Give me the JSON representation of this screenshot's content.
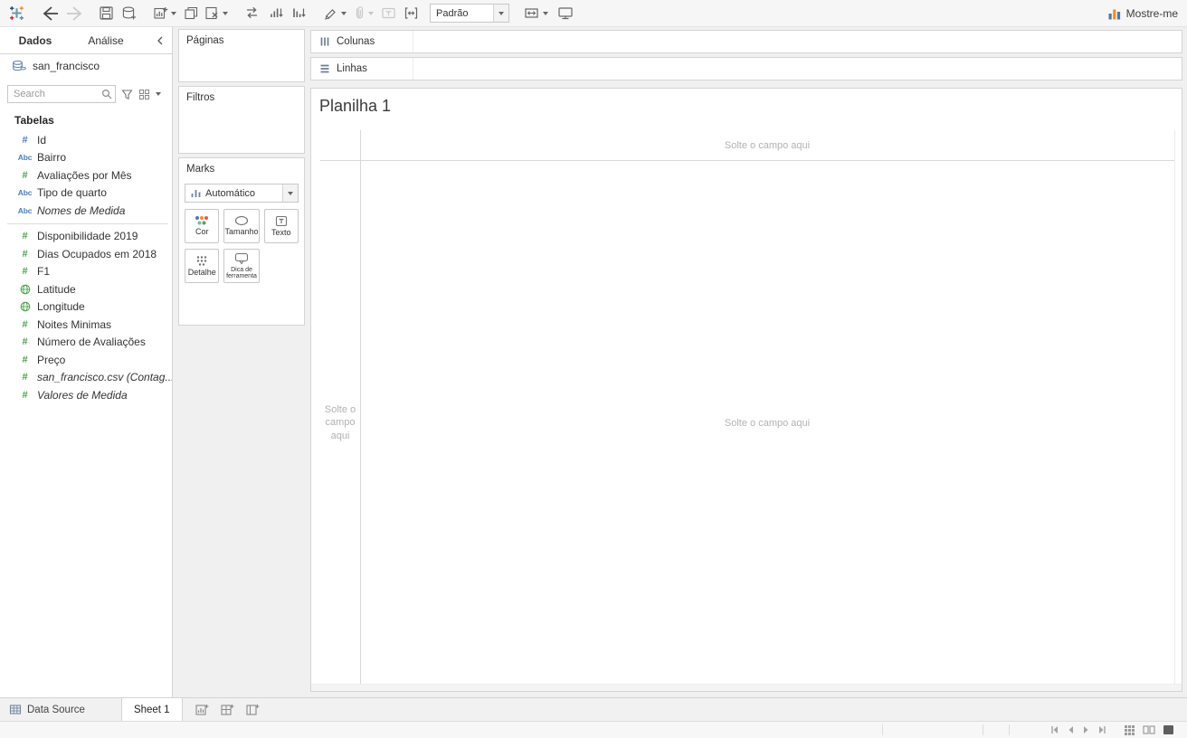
{
  "toolbar": {
    "format_select_value": "Padrão",
    "show_me_label": "Mostre-me"
  },
  "sidebar": {
    "tab_data": "Dados",
    "tab_analytics": "Análise",
    "connection_name": "san_francisco",
    "search_placeholder": "Search",
    "tables_title": "Tabelas",
    "fields": [
      {
        "label": "Id",
        "glyph": "#",
        "type": "number",
        "color": "blue"
      },
      {
        "label": "Bairro",
        "glyph": "Abc",
        "type": "string",
        "color": "blue"
      },
      {
        "label": "Avaliações por Mês",
        "glyph": "#",
        "type": "number",
        "color": "green"
      },
      {
        "label": "Tipo de quarto",
        "glyph": "Abc",
        "type": "string",
        "color": "blue"
      },
      {
        "label": "Nomes de Medida",
        "glyph": "Abc",
        "type": "string",
        "color": "blue",
        "italic": true
      },
      {
        "label": "Disponibilidade 2019",
        "glyph": "#",
        "type": "number",
        "color": "green"
      },
      {
        "label": "Dias Ocupados em 2018",
        "glyph": "#",
        "type": "number",
        "color": "green"
      },
      {
        "label": "F1",
        "glyph": "#",
        "type": "number",
        "color": "green"
      },
      {
        "label": "Latitude",
        "glyph": "globe",
        "type": "geo",
        "color": "green"
      },
      {
        "label": "Longitude",
        "glyph": "globe",
        "type": "geo",
        "color": "green"
      },
      {
        "label": "Noites Minimas",
        "glyph": "#",
        "type": "number",
        "color": "green"
      },
      {
        "label": "Número de Avaliações",
        "glyph": "#",
        "type": "number",
        "color": "green"
      },
      {
        "label": "Preço",
        "glyph": "#",
        "type": "number",
        "color": "green"
      },
      {
        "label": "san_francisco.csv (Contag...",
        "glyph": "#",
        "type": "number",
        "color": "green",
        "italic": true
      },
      {
        "label": "Valores de Medida",
        "glyph": "#",
        "type": "number",
        "color": "green",
        "italic": true
      }
    ]
  },
  "cards": {
    "pages_title": "Páginas",
    "filters_title": "Filtros",
    "marks_title": "Marks",
    "mark_type_value": "Automático",
    "buttons": {
      "color": "Cor",
      "size": "Tamanho",
      "text": "Texto",
      "detail": "Detalhe",
      "tooltip": "Dica de ferramenta"
    }
  },
  "shelves": {
    "columns_label": "Colunas",
    "rows_label": "Linhas"
  },
  "canvas": {
    "sheet_title": "Planilha 1",
    "drop_hint": "Solte o campo aqui"
  },
  "bottom": {
    "data_source_label": "Data Source",
    "sheet_tab_label": "Sheet 1"
  },
  "colors": {
    "dimension_blue": "#4a7ebb",
    "measure_green": "#4d9e4d",
    "accent_orange": "#f28e2b"
  }
}
